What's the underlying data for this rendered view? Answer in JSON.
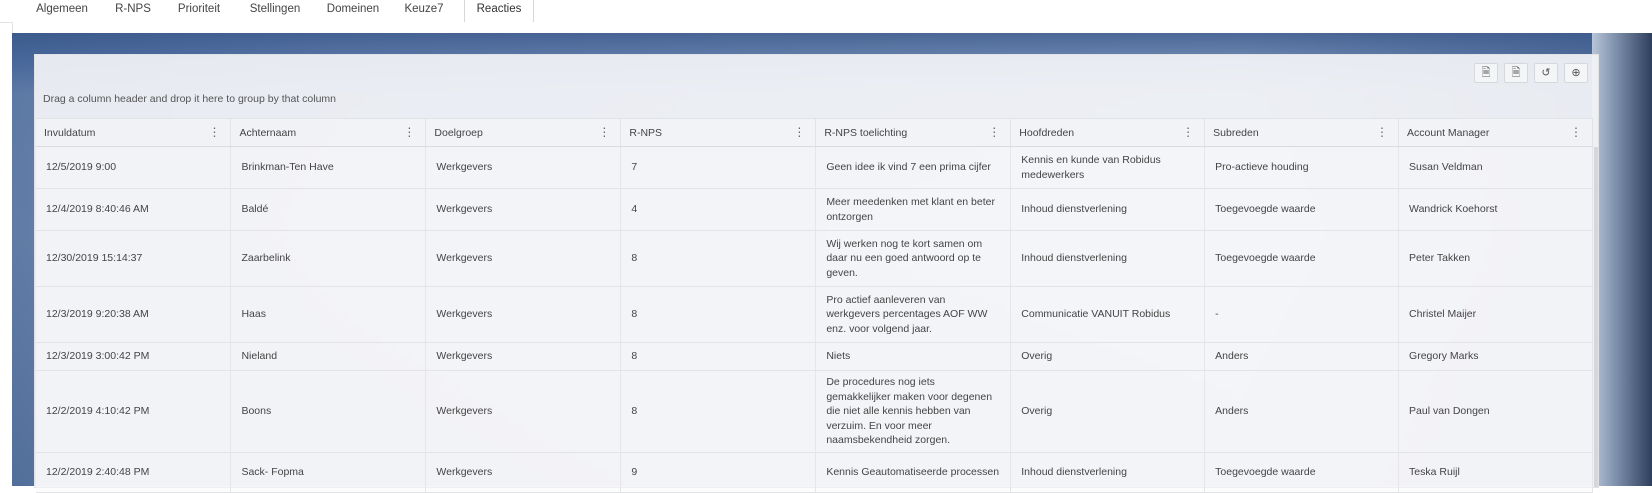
{
  "tabs": [
    "Algemeen",
    "R-NPS",
    "Prioriteit",
    "Stellingen",
    "Domeinen",
    "Keuze7",
    "Reacties"
  ],
  "active_tab": "Reacties",
  "toolbar": {
    "icons": [
      "pdf-export-icon",
      "excel-export-icon",
      "undo-icon",
      "zoom-icon"
    ]
  },
  "group_hint": "Drag a column header and drop it here to group by that column",
  "columns": [
    "Invuldatum",
    "Achternaam",
    "Doelgroep",
    "R-NPS",
    "R-NPS toelichting",
    "Hoofdreden",
    "Subreden",
    "Account Manager"
  ],
  "rows": [
    [
      "12/5/2019 9:00",
      "Brinkman-Ten Have",
      "Werkgevers",
      "7",
      "Geen idee ik vind 7 een prima cijfer",
      "Kennis en kunde van Robidus medewerkers",
      "Pro-actieve houding",
      "Susan Veldman"
    ],
    [
      "12/4/2019 8:40:46 AM",
      "Baldé",
      "Werkgevers",
      "4",
      "Meer meedenken met klant en beter ontzorgen",
      "Inhoud dienstverlening",
      "Toegevoegde waarde",
      "Wandrick Koehorst"
    ],
    [
      "12/30/2019 15:14:37",
      "Zaarbelink",
      "Werkgevers",
      "8",
      "Wij werken nog te kort samen om daar nu een goed antwoord op te geven.",
      "Inhoud dienstverlening",
      "Toegevoegde waarde",
      "Peter Takken"
    ],
    [
      "12/3/2019 9:20:38 AM",
      "Haas",
      "Werkgevers",
      "8",
      "Pro actief aanleveren van werkgevers percentages AOF WW enz. voor volgend jaar.",
      "Communicatie VANUIT Robidus",
      "-",
      "Christel Maijer"
    ],
    [
      "12/3/2019 3:00:42 PM",
      "Nieland",
      "Werkgevers",
      "8",
      "Niets",
      "Overig",
      "Anders",
      "Gregory Marks"
    ],
    [
      "12/2/2019 4:10:42 PM",
      "Boons",
      "Werkgevers",
      "8",
      "De procedures nog iets gemakkelijker maken voor degenen die niet alle kennis hebben van verzuim. En voor meer naamsbekendheid zorgen.",
      "Overig",
      "Anders",
      "Paul van Dongen"
    ],
    [
      "12/2/2019 2:40:48 PM",
      "Sack- Fopma",
      "Werkgevers",
      "9",
      "Kennis Geautomatiseerde processen",
      "Inhoud dienstverlening",
      "Toegevoegde waarde",
      "Teska Ruijl"
    ]
  ]
}
